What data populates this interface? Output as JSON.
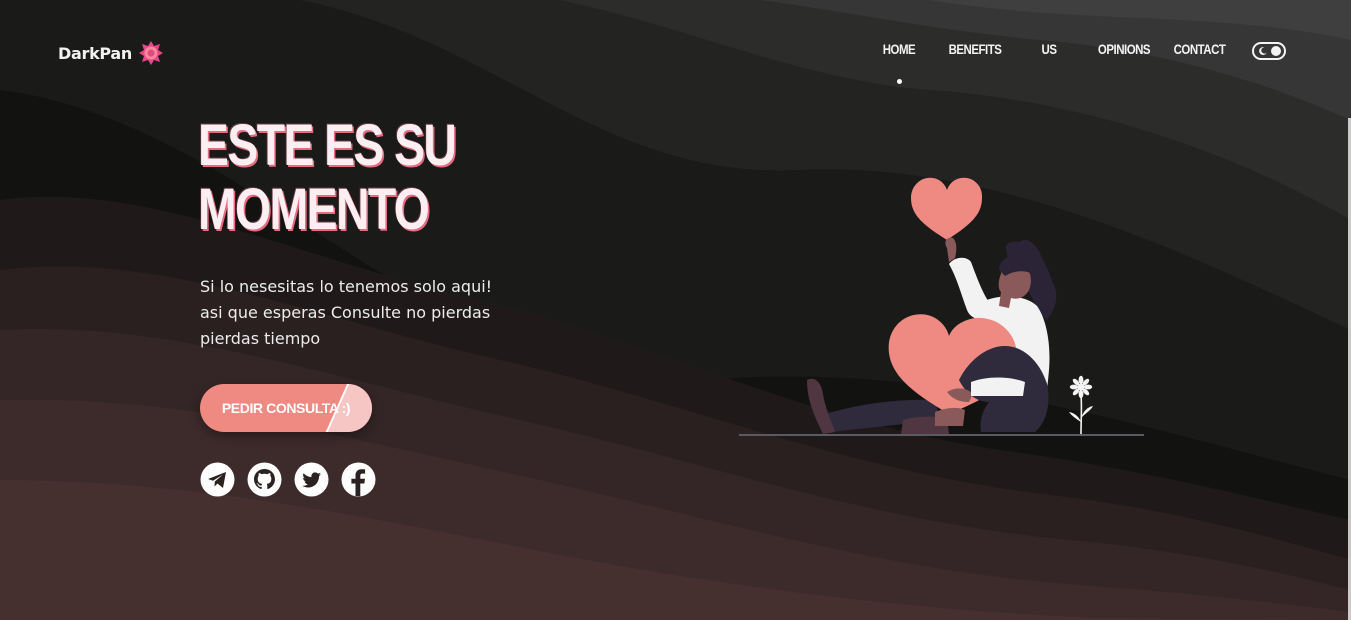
{
  "brand": {
    "name": "DarkPan",
    "logo_icon": "flower-badge-icon",
    "accent": "#ee8a82"
  },
  "nav": {
    "items": [
      {
        "label": "HOME",
        "active": true
      },
      {
        "label": "BENEFITS",
        "active": false
      },
      {
        "label": "US",
        "active": false
      },
      {
        "label": "OPINIONS",
        "active": false
      },
      {
        "label": "CONTACT",
        "active": false
      }
    ],
    "theme_toggle_icon": "moon-toggle-icon"
  },
  "hero": {
    "title_line1": "ESTE ES SU",
    "title_line2": "MOMENTO",
    "subtitle_line1": "Si lo nesesitas lo tenemos solo aqui!",
    "subtitle_line2": "asi que esperas Consulte no pierdas",
    "subtitle_line3": "pierdas tiempo",
    "cta_label": "PEDIR CONSULTA :)"
  },
  "socials": [
    {
      "icon": "telegram-icon"
    },
    {
      "icon": "github-icon"
    },
    {
      "icon": "twitter-icon"
    },
    {
      "icon": "facebook-icon"
    }
  ],
  "colors": {
    "background_dark": "#141412",
    "wave_brown": "#4b2e30",
    "heart": "#ee8a82",
    "text": "#f4f4f4"
  }
}
